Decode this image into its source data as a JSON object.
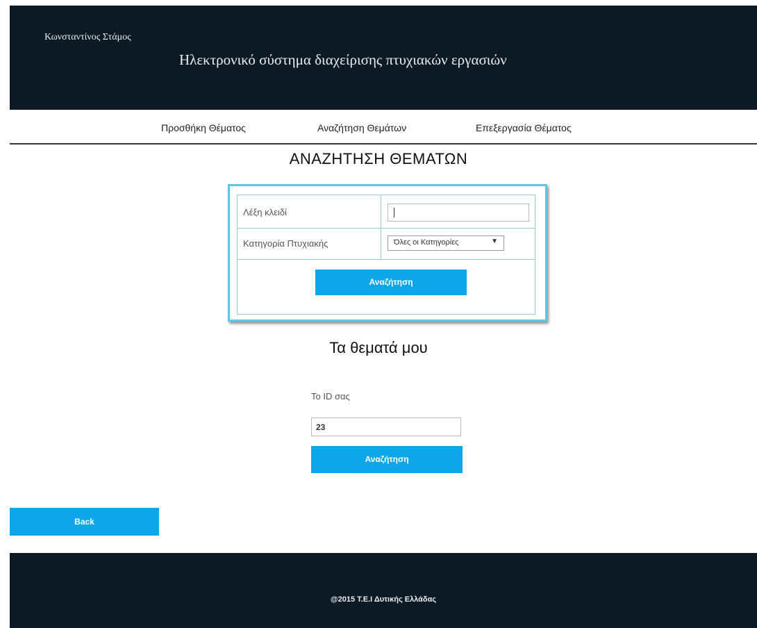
{
  "header": {
    "user_name": "Κωνσταντίνος Στάμος",
    "site_title": "Ηλεκτρονικό σύστημα διαχείρισης πτυχιακών εργασιών"
  },
  "nav": {
    "items": [
      {
        "label": "Προσθήκη Θέματος"
      },
      {
        "label": "Αναζήτηση Θεμάτων"
      },
      {
        "label": "Επεξεργασία Θέματος"
      }
    ]
  },
  "search": {
    "heading": "ΑΝΑΖΗΤΗΣΗ ΘΕΜΑΤΩΝ",
    "keyword_label": "Λέξη κλειδί",
    "keyword_value": "",
    "category_label": "Κατηγορία Πτυχιακής",
    "category_selected": "Όλες οι Κατηγορίες",
    "search_button": "Αναζήτηση"
  },
  "my_topics": {
    "heading": "Τα θεματά μου",
    "id_label": "Το ID σας",
    "id_value": "23",
    "search_button": "Αναζήτηση"
  },
  "back_button": "Back",
  "footer": {
    "copyright": "@2015 Τ.Ε.Ι Δυτικής Ελλάδας"
  },
  "colors": {
    "header_bg": "#0b1a24",
    "button_bg": "#0ea5e9",
    "panel_border": "#5ec7e6"
  }
}
